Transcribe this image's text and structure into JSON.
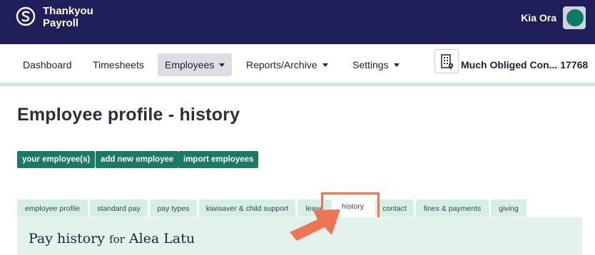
{
  "brand": {
    "line1": "Thankyou",
    "line2": "Payroll"
  },
  "user": {
    "greeting": "Kia Ora"
  },
  "nav": {
    "dashboard": "Dashboard",
    "timesheets": "Timesheets",
    "employees": "Employees",
    "reports": "Reports/Archive",
    "settings": "Settings",
    "company": "Much Obliged Con... 17768"
  },
  "page": {
    "title": "Employee profile - history"
  },
  "actions": {
    "your_employees": "your employee(s)",
    "add_new": "add new employee",
    "import": "import employees"
  },
  "tabs": {
    "employee_profile": "employee profile",
    "standard_pay": "standard pay",
    "pay_types": "pay types",
    "kiwisaver": "kiwisaver & child support",
    "leave": "leave",
    "history": "history",
    "contact": "contact",
    "fines": "fines & payments",
    "giving": "giving"
  },
  "panel": {
    "title": "Pay history",
    "for_word": "for",
    "employee_name": "Alea Latu"
  },
  "colors": {
    "header": "#1f1f5c",
    "accent": "#1a7a63",
    "tab": "#d6efe6",
    "highlight": "#ee7554"
  }
}
